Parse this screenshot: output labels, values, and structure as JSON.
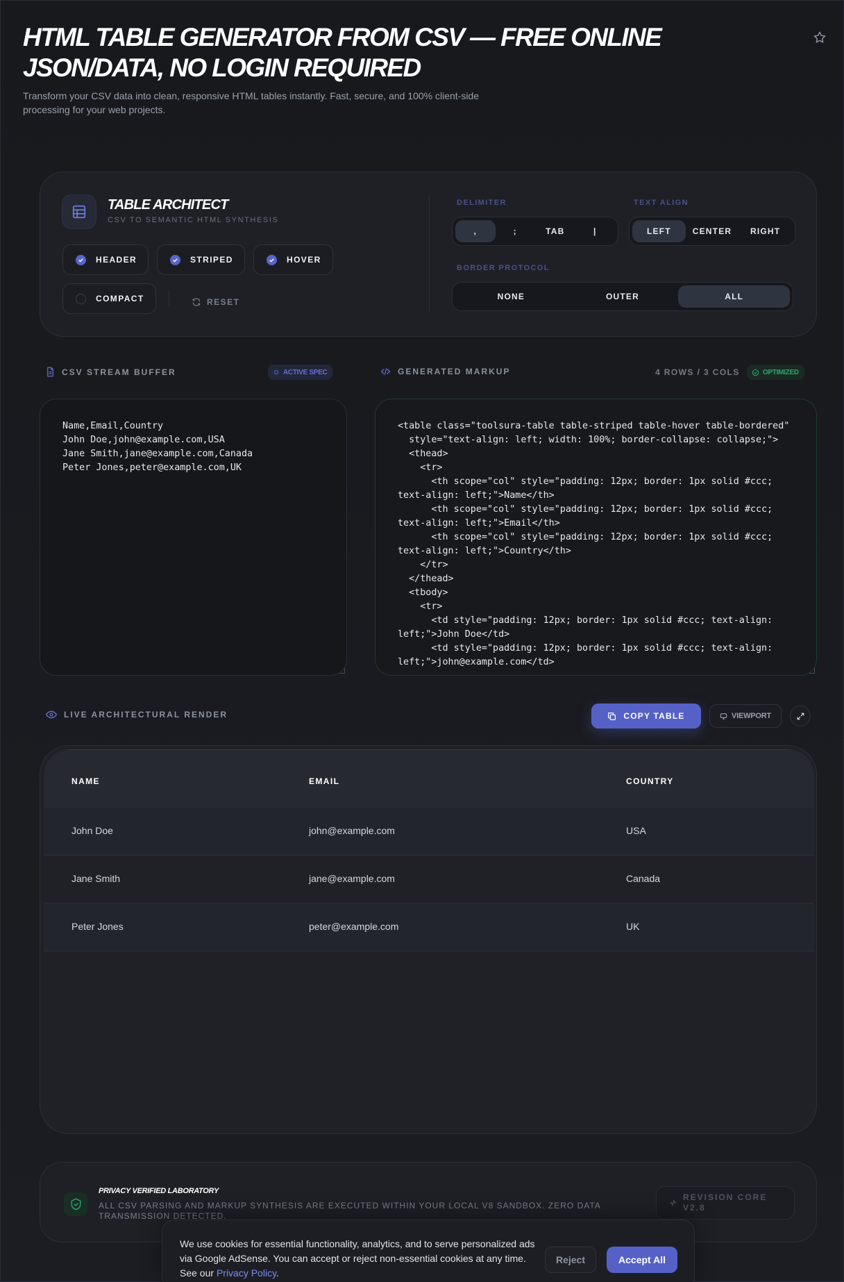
{
  "header": {
    "title": "HTML TABLE GENERATOR FROM CSV — FREE ONLINE JSON/DATA, NO LOGIN REQUIRED",
    "subtitle": "Transform your CSV data into clean, responsive HTML tables instantly. Fast, secure, and 100% client-side processing for your web projects."
  },
  "architect": {
    "title": "TABLE ARCHITECT",
    "subtitle": "CSV TO SEMANTIC HTML SYNTHESIS",
    "toggles": [
      {
        "label": "HEADER",
        "checked": true
      },
      {
        "label": "STRIPED",
        "checked": true
      },
      {
        "label": "HOVER",
        "checked": true
      },
      {
        "label": "COMPACT",
        "checked": false
      }
    ],
    "reset_label": "RESET",
    "delimiter": {
      "label": "DELIMITER",
      "options": [
        ",",
        ";",
        "TAB",
        "|"
      ],
      "selected": ","
    },
    "text_align": {
      "label": "TEXT ALIGN",
      "options": [
        "LEFT",
        "CENTER",
        "RIGHT"
      ],
      "selected": "LEFT"
    },
    "border": {
      "label": "BORDER PROTOCOL",
      "options": [
        "NONE",
        "OUTER",
        "ALL"
      ],
      "selected": "ALL"
    }
  },
  "csv_panel": {
    "label": "CSV STREAM BUFFER",
    "badge": "ACTIVE SPEC",
    "content": "Name,Email,Country\nJohn Doe,john@example.com,USA\nJane Smith,jane@example.com,Canada\nPeter Jones,peter@example.com,UK"
  },
  "markup_panel": {
    "label": "GENERATED MARKUP",
    "dims": "4 ROWS / 3 COLS",
    "badge": "OPTIMIZED",
    "content": "<table class=\"toolsura-table table-striped table-hover table-bordered\"\n  style=\"text-align: left; width: 100%; border-collapse: collapse;\">\n  <thead>\n    <tr>\n      <th scope=\"col\" style=\"padding: 12px; border: 1px solid #ccc; text-align: left;\">Name</th>\n      <th scope=\"col\" style=\"padding: 12px; border: 1px solid #ccc; text-align: left;\">Email</th>\n      <th scope=\"col\" style=\"padding: 12px; border: 1px solid #ccc; text-align: left;\">Country</th>\n    </tr>\n  </thead>\n  <tbody>\n    <tr>\n      <td style=\"padding: 12px; border: 1px solid #ccc; text-align: left;\">John Doe</td>\n      <td style=\"padding: 12px; border: 1px solid #ccc; text-align: left;\">john@example.com</td>"
  },
  "render": {
    "label": "LIVE ARCHITECTURAL RENDER",
    "copy_label": "COPY TABLE",
    "viewport_label": "VIEWPORT",
    "headers": [
      "NAME",
      "EMAIL",
      "COUNTRY"
    ],
    "rows": [
      [
        "John Doe",
        "john@example.com",
        "USA"
      ],
      [
        "Jane Smith",
        "jane@example.com",
        "Canada"
      ],
      [
        "Peter Jones",
        "peter@example.com",
        "UK"
      ]
    ]
  },
  "privacy": {
    "title": "PRIVACY VERIFIED LABORATORY",
    "text": "ALL CSV PARSING AND MARKUP SYNTHESIS ARE EXECUTED WITHIN YOUR LOCAL V8 SANDBOX. ZERO DATA TRANSMISSION DETECTED.",
    "revision": "REVISION CORE V2.8"
  },
  "cookie": {
    "text": "We use cookies for essential functionality, analytics, and to serve personalized ads via Google AdSense. You can accept or reject non-essential cookies at any time. See our",
    "link": "Privacy Policy",
    "after_link": ".",
    "reject_label": "Reject",
    "accept_label": "Accept All"
  },
  "colors": {
    "background": "#1a1c21",
    "accent": "#5661c7",
    "success": "#2fa572",
    "panel": "#1e2026"
  }
}
